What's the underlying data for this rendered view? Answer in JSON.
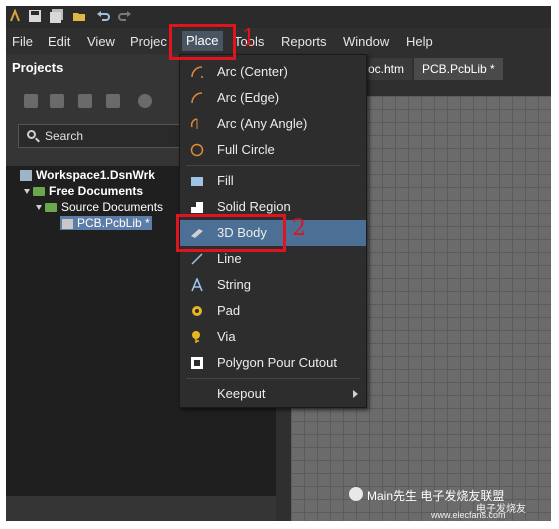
{
  "menubar": {
    "items": [
      "File",
      "Edit",
      "View",
      "Projec",
      "Place",
      "Tools",
      "Reports",
      "Window",
      "Help"
    ],
    "active": "Place"
  },
  "projects_panel": {
    "title": "Projects",
    "search_placeholder": "Search",
    "tree": {
      "workspace": "Workspace1.DsnWrk",
      "free_documents": "Free Documents",
      "source_documents": "Source Documents",
      "file": "PCB.PcbLib *"
    }
  },
  "tabs": [
    {
      "label": "oc.htm"
    },
    {
      "label": "PCB.PcbLib *"
    }
  ],
  "place_menu": {
    "items": [
      {
        "label": "Arc (Center)",
        "icon": "arc-center-icon"
      },
      {
        "label": "Arc (Edge)",
        "icon": "arc-edge-icon"
      },
      {
        "label": "Arc (Any Angle)",
        "icon": "arc-any-angle-icon"
      },
      {
        "label": "Full Circle",
        "icon": "full-circle-icon"
      },
      {
        "label": "Fill",
        "icon": "fill-icon"
      },
      {
        "label": "Solid Region",
        "icon": "solid-region-icon"
      },
      {
        "label": "3D Body",
        "icon": "3d-body-icon"
      },
      {
        "label": "Line",
        "icon": "line-icon"
      },
      {
        "label": "String",
        "icon": "string-icon"
      },
      {
        "label": "Pad",
        "icon": "pad-icon"
      },
      {
        "label": "Via",
        "icon": "via-icon"
      },
      {
        "label": "Polygon Pour Cutout",
        "icon": "polygon-pour-cutout-icon"
      },
      {
        "label": "Keepout",
        "icon": ""
      }
    ],
    "highlighted": "3D Body"
  },
  "annotations": {
    "step1": "1",
    "step2": "2",
    "color": "#e0141e"
  },
  "watermark": {
    "text": "Main先生 电子发烧友联盟",
    "site": "www.elecfans.com",
    "brand": "电子发烧友"
  },
  "colors": {
    "highlight": "#4c6f96",
    "selection": "#5b7da8",
    "folder": "#6aa84f"
  }
}
